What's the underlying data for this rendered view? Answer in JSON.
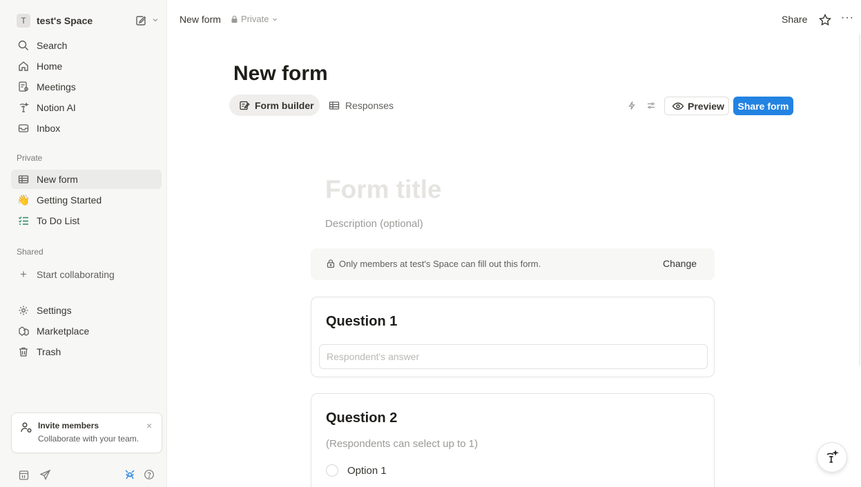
{
  "workspace": {
    "initial": "T",
    "name": "test's Space"
  },
  "nav": {
    "search": "Search",
    "home": "Home",
    "meetings": "Meetings",
    "notion_ai": "Notion AI",
    "inbox": "Inbox"
  },
  "sections": {
    "private": "Private",
    "shared": "Shared"
  },
  "private_pages": [
    {
      "label": "New form",
      "icon": "table-icon"
    },
    {
      "label": "Getting Started",
      "icon": "waving-hand-icon"
    },
    {
      "label": "To Do List",
      "icon": "checklist-icon"
    }
  ],
  "shared_items": {
    "start_collaborating": "Start collaborating"
  },
  "bottom_nav": {
    "settings": "Settings",
    "marketplace": "Marketplace",
    "trash": "Trash"
  },
  "invite": {
    "title": "Invite members",
    "subtitle": "Collaborate with your team.",
    "close": "×"
  },
  "topbar": {
    "breadcrumb": "New form",
    "privacy": "Private",
    "share": "Share",
    "more": "···"
  },
  "page": {
    "title": "New form"
  },
  "tabs": {
    "builder": "Form builder",
    "responses": "Responses"
  },
  "actions": {
    "preview": "Preview",
    "share_form": "Share form"
  },
  "form": {
    "title_placeholder": "Form title",
    "description_placeholder": "Description (optional)",
    "access_message": "Only members at test's Space can fill out this form.",
    "access_change": "Change",
    "questions": [
      {
        "title": "Question 1",
        "answer_placeholder": "Respondent's answer"
      },
      {
        "title": "Question 2",
        "hint": "(Respondents can select up to 1)",
        "options": [
          "Option 1"
        ]
      }
    ]
  },
  "colors": {
    "accent": "#2383e2",
    "sidebar_bg": "#f7f7f5",
    "text": "#37352f"
  }
}
